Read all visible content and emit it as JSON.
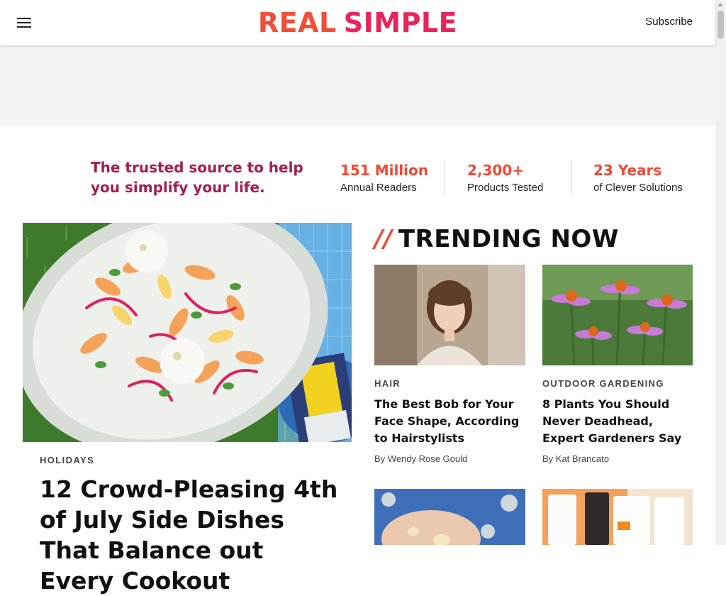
{
  "header": {
    "menu_icon": "hamburger-menu-icon",
    "logo_word1": "REAL",
    "logo_word2": "SIMPLE",
    "subscribe_label": "Subscribe",
    "colors": {
      "logo_real": "#f04e37",
      "logo_simple": "#e8245a"
    }
  },
  "tagline": "The trusted source to help you simplify your life.",
  "stats": [
    {
      "value": "151 Million",
      "label": "Annual Readers"
    },
    {
      "value": "2,300+",
      "label": "Products Tested"
    },
    {
      "value": "23 Years",
      "label": "of Clever Solutions"
    }
  ],
  "feature": {
    "kicker": "HOLIDAYS",
    "title": "12 Crowd-Pleasing 4th of July Side Dishes That Balance out Every Cookout"
  },
  "trending": {
    "slash": "//",
    "heading": "TRENDING NOW",
    "cards": [
      {
        "kicker": "HAIR",
        "title": "The Best Bob for Your Face Shape, According to Hairstylists",
        "byline": "By Wendy Rose Gould"
      },
      {
        "kicker": "OUTDOOR GARDENING",
        "title": "8 Plants You Should Never Deadhead, Expert Gardeners Say",
        "byline": "By Kat Brancato"
      }
    ]
  },
  "accent_color": "#ee4a35",
  "tagline_color": "#a51e4b"
}
